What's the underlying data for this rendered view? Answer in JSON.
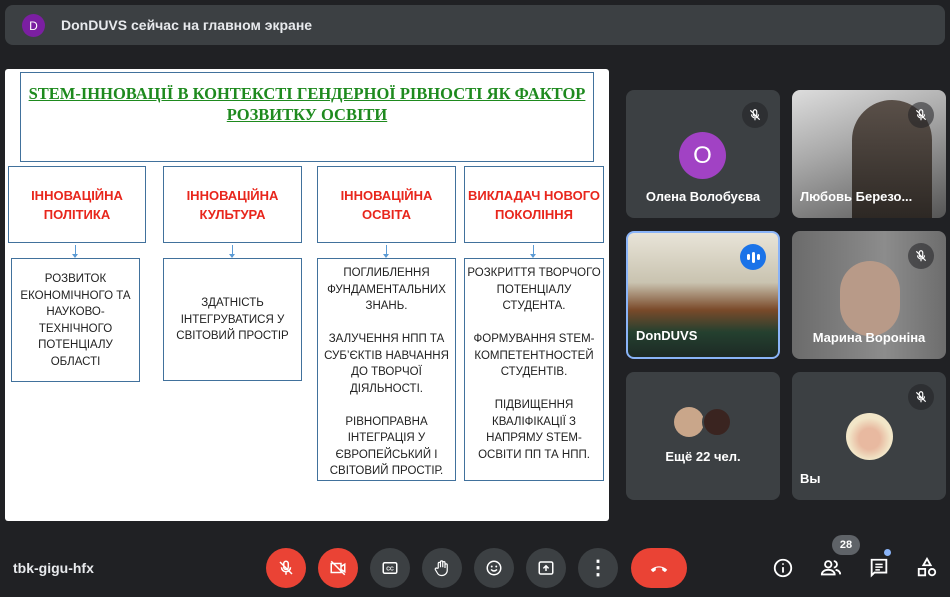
{
  "banner": {
    "avatar_letter": "D",
    "text": "DonDUVS сейчас на главном экране"
  },
  "slide": {
    "title": "STEM-ІННОВАЦІЇ В КОНТЕКСТІ ГЕНДЕРНОЇ РІВНОСТІ ЯК ФАКТОР РОЗВИТКУ ОСВІТИ",
    "columns": [
      {
        "heading": "ІННОВАЦІЙНА ПОЛІТИКА",
        "body": "РОЗВИТОК ЕКОНОМІЧНОГО ТА НАУКОВО-ТЕХНІЧНОГО ПОТЕНЦІАЛУ ОБЛАСТІ"
      },
      {
        "heading": "ІННОВАЦІЙНА КУЛЬТУРА",
        "body": "ЗДАТНІСТЬ ІНТЕГРУВАТИСЯ У СВІТОВИЙ ПРОСТІР"
      },
      {
        "heading": "ІННОВАЦІЙНА ОСВІТА",
        "body": "ПОГЛИБЛЕННЯ ФУНДАМЕНТАЛЬНИХ ЗНАНЬ.\n\nЗАЛУЧЕННЯ  НПП ТА СУБ’ЄКТІВ НАВЧАННЯ ДО ТВОРЧОЇ ДІЯЛЬНОСТІ.\n\nРІВНОПРАВНА ІНТЕГРАЦІЯ У ЄВРОПЕЙСЬКИЙ І СВІТОВИЙ ПРОСТІР."
      },
      {
        "heading": "ВИКЛАДАЧ НОВОГО ПОКОЛІННЯ",
        "body": "РОЗКРИТТЯ ТВОРЧОГО ПОТЕНЦІАЛУ СТУДЕНТА.\n\nФОРМУВАННЯ STEM-КОМПЕТЕНТНОСТЕЙ СТУДЕНТІВ.\n\nПІДВИЩЕННЯ КВАЛІФІКАЦІЇ З НАПРЯМУ STEM-ОСВІТИ ПП ТА НПП."
      }
    ]
  },
  "participants": [
    {
      "name": "Олена Волобуєва",
      "avatar_letter": "O",
      "avatar_color": "#a142c4"
    },
    {
      "name": "Любовь Березо..."
    },
    {
      "name": "DonDUVS"
    },
    {
      "name": "Марина Вороніна"
    },
    {
      "name": "Ещё 22 чел."
    },
    {
      "name": "Вы"
    }
  ],
  "bottom": {
    "meeting_code": "tbk-gigu-hfx",
    "people_count": "28"
  },
  "colors": {
    "bg": "#202124",
    "danger": "#ea4335",
    "accent": "#8ab4f8"
  }
}
